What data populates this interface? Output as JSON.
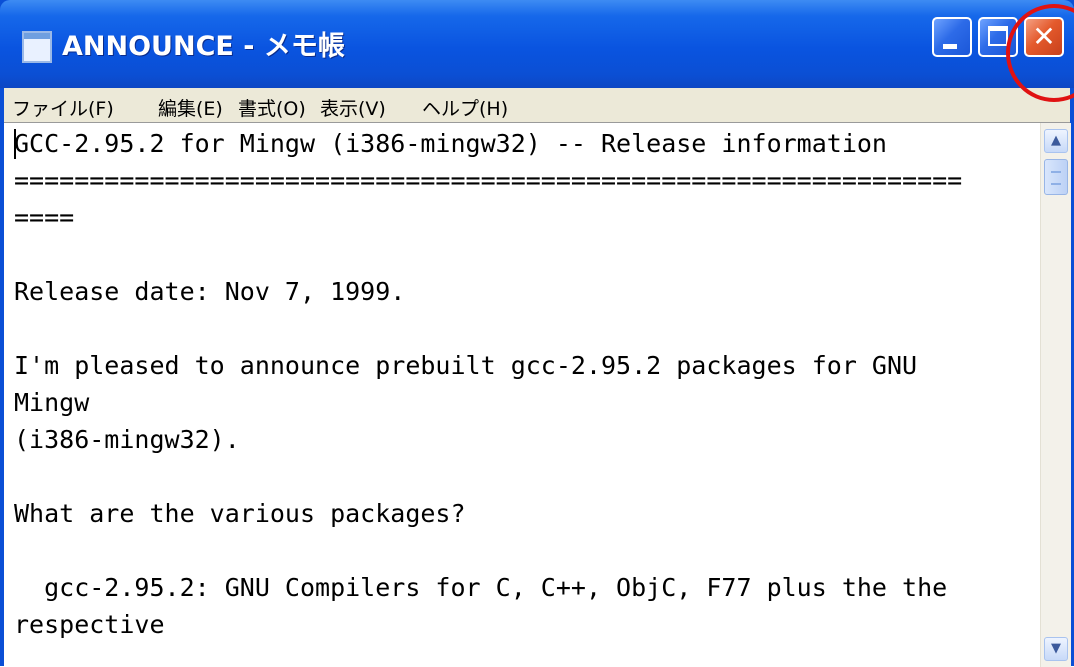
{
  "window": {
    "title": "ANNOUNCE - メモ帳",
    "icon": "notepad-icon",
    "controls": {
      "minimize": "minimize-icon",
      "maximize": "maximize-icon",
      "close": "close-icon",
      "close_glyph": "✕"
    }
  },
  "menu": [
    {
      "label": "ファイル(F)"
    },
    {
      "label": "編集(E)"
    },
    {
      "label": "書式(O)"
    },
    {
      "label": "表示(V)"
    },
    {
      "label": "ヘルプ(H)"
    }
  ],
  "document": {
    "lines": [
      "GCC-2.95.2 for Mingw (i386-mingw32) -- Release information",
      "===============================================================",
      "====",
      "",
      "Release date: Nov 7, 1999.",
      "",
      "I'm pleased to announce prebuilt gcc-2.95.2 packages for GNU",
      "Mingw",
      "(i386-mingw32).",
      "",
      "What are the various packages?",
      "",
      "  gcc-2.95.2: GNU Compilers for C, C++, ObjC, F77 plus the the",
      "respective"
    ]
  },
  "scrollbar": {
    "up_arrow": "▲",
    "down_arrow": "▼",
    "position": 0.05
  },
  "annotation": {
    "color": "#e01212"
  }
}
